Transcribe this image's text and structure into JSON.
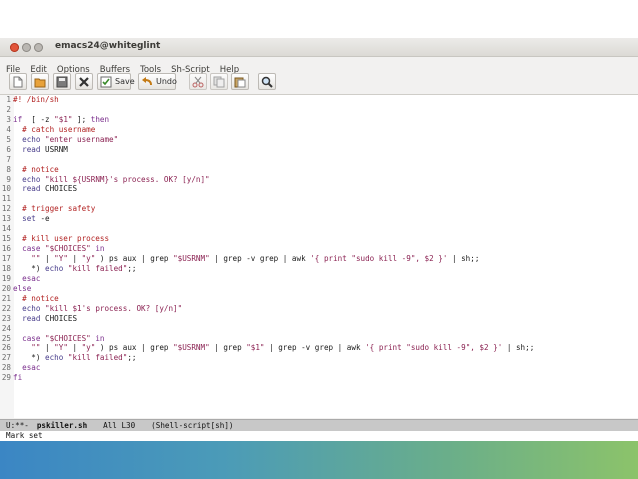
{
  "window": {
    "title": "emacs24@whiteglint"
  },
  "menubar": [
    "File",
    "Edit",
    "Options",
    "Buffers",
    "Tools",
    "Sh-Script",
    "Help"
  ],
  "toolbar": {
    "save_label": "Save",
    "undo_label": "Undo"
  },
  "code_lines": [
    {
      "n": "1",
      "t": [
        [
          "cm",
          "#! /bin/sh"
        ]
      ]
    },
    {
      "n": "2",
      "t": []
    },
    {
      "n": "3",
      "t": [
        [
          "kw",
          "if"
        ],
        [
          "",
          "  [ -z "
        ],
        [
          "st",
          "\"$1\""
        ],
        [
          "",
          " ]; "
        ],
        [
          "kw",
          "then"
        ]
      ]
    },
    {
      "n": "4",
      "t": [
        [
          "",
          "  "
        ],
        [
          "cm",
          "# catch username"
        ]
      ]
    },
    {
      "n": "5",
      "t": [
        [
          "",
          "  "
        ],
        [
          "bi",
          "echo"
        ],
        [
          "",
          " "
        ],
        [
          "st",
          "\"enter username\""
        ]
      ]
    },
    {
      "n": "6",
      "t": [
        [
          "",
          "  "
        ],
        [
          "bi",
          "read"
        ],
        [
          "",
          " USRNM"
        ]
      ]
    },
    {
      "n": "7",
      "t": []
    },
    {
      "n": "8",
      "t": [
        [
          "",
          "  "
        ],
        [
          "cm",
          "# notice"
        ]
      ]
    },
    {
      "n": "9",
      "t": [
        [
          "",
          "  "
        ],
        [
          "bi",
          "echo"
        ],
        [
          "",
          " "
        ],
        [
          "st",
          "\"kill ${USRNM}'s process. OK? [y/n]\""
        ]
      ]
    },
    {
      "n": "10",
      "t": [
        [
          "",
          "  "
        ],
        [
          "bi",
          "read"
        ],
        [
          "",
          " CHOICES"
        ]
      ]
    },
    {
      "n": "11",
      "t": []
    },
    {
      "n": "12",
      "t": [
        [
          "",
          "  "
        ],
        [
          "cm",
          "# trigger safety"
        ]
      ]
    },
    {
      "n": "13",
      "t": [
        [
          "",
          "  "
        ],
        [
          "bi",
          "set"
        ],
        [
          "",
          " -e"
        ]
      ]
    },
    {
      "n": "14",
      "t": []
    },
    {
      "n": "15",
      "t": [
        [
          "",
          "  "
        ],
        [
          "cm",
          "# kill user process"
        ]
      ]
    },
    {
      "n": "16",
      "t": [
        [
          "",
          "  "
        ],
        [
          "kw",
          "case"
        ],
        [
          "",
          " "
        ],
        [
          "st",
          "\"$CHOICES\""
        ],
        [
          "",
          " "
        ],
        [
          "kw",
          "in"
        ]
      ]
    },
    {
      "n": "17",
      "t": [
        [
          "",
          "    "
        ],
        [
          "st",
          "\"\""
        ],
        [
          "",
          " | "
        ],
        [
          "st",
          "\"Y\""
        ],
        [
          "",
          " | "
        ],
        [
          "st",
          "\"y\""
        ],
        [
          "",
          " ) ps aux | grep "
        ],
        [
          "st",
          "\"$USRNM\""
        ],
        [
          "",
          " | grep -v grep | awk "
        ],
        [
          "st",
          "'{ print \"sudo kill -9\", $2 }'"
        ],
        [
          "",
          " | sh;;"
        ]
      ]
    },
    {
      "n": "18",
      "t": [
        [
          "",
          "    *) "
        ],
        [
          "bi",
          "echo"
        ],
        [
          "",
          " "
        ],
        [
          "st",
          "\"kill failed\""
        ],
        [
          "",
          ";;"
        ]
      ]
    },
    {
      "n": "19",
      "t": [
        [
          "",
          "  "
        ],
        [
          "kw",
          "esac"
        ]
      ]
    },
    {
      "n": "20",
      "t": [
        [
          "kw",
          "else"
        ]
      ]
    },
    {
      "n": "21",
      "t": [
        [
          "",
          "  "
        ],
        [
          "cm",
          "# notice"
        ]
      ]
    },
    {
      "n": "22",
      "t": [
        [
          "",
          "  "
        ],
        [
          "bi",
          "echo"
        ],
        [
          "",
          " "
        ],
        [
          "st",
          "\"kill $1's process. OK? [y/n]\""
        ]
      ]
    },
    {
      "n": "23",
      "t": [
        [
          "",
          "  "
        ],
        [
          "bi",
          "read"
        ],
        [
          "",
          " CHOICES"
        ]
      ]
    },
    {
      "n": "24",
      "t": []
    },
    {
      "n": "25",
      "t": [
        [
          "",
          "  "
        ],
        [
          "kw",
          "case"
        ],
        [
          "",
          " "
        ],
        [
          "st",
          "\"$CHOICES\""
        ],
        [
          "",
          " "
        ],
        [
          "kw",
          "in"
        ]
      ]
    },
    {
      "n": "26",
      "t": [
        [
          "",
          "    "
        ],
        [
          "st",
          "\"\""
        ],
        [
          "",
          " | "
        ],
        [
          "st",
          "\"Y\""
        ],
        [
          "",
          " | "
        ],
        [
          "st",
          "\"y\""
        ],
        [
          "",
          " ) ps aux | grep "
        ],
        [
          "st",
          "\"$USRNM\""
        ],
        [
          "",
          " | grep "
        ],
        [
          "st",
          "\"$1\""
        ],
        [
          "",
          " | grep -v grep | awk "
        ],
        [
          "st",
          "'{ print \"sudo kill -9\", $2 }'"
        ],
        [
          "",
          " | sh;;"
        ]
      ]
    },
    {
      "n": "27",
      "t": [
        [
          "",
          "    *) "
        ],
        [
          "bi",
          "echo"
        ],
        [
          "",
          " "
        ],
        [
          "st",
          "\"kill failed\""
        ],
        [
          "",
          ";;"
        ]
      ]
    },
    {
      "n": "28",
      "t": [
        [
          "",
          "  "
        ],
        [
          "kw",
          "esac"
        ]
      ]
    },
    {
      "n": "29",
      "t": [
        [
          "kw",
          "fi"
        ]
      ]
    }
  ],
  "modeline": {
    "status": "U:**-",
    "buffer": "pskiller.sh",
    "position": "All L30",
    "mode": "(Shell-script[sh])"
  },
  "minibuffer": {
    "message": "Mark set"
  }
}
